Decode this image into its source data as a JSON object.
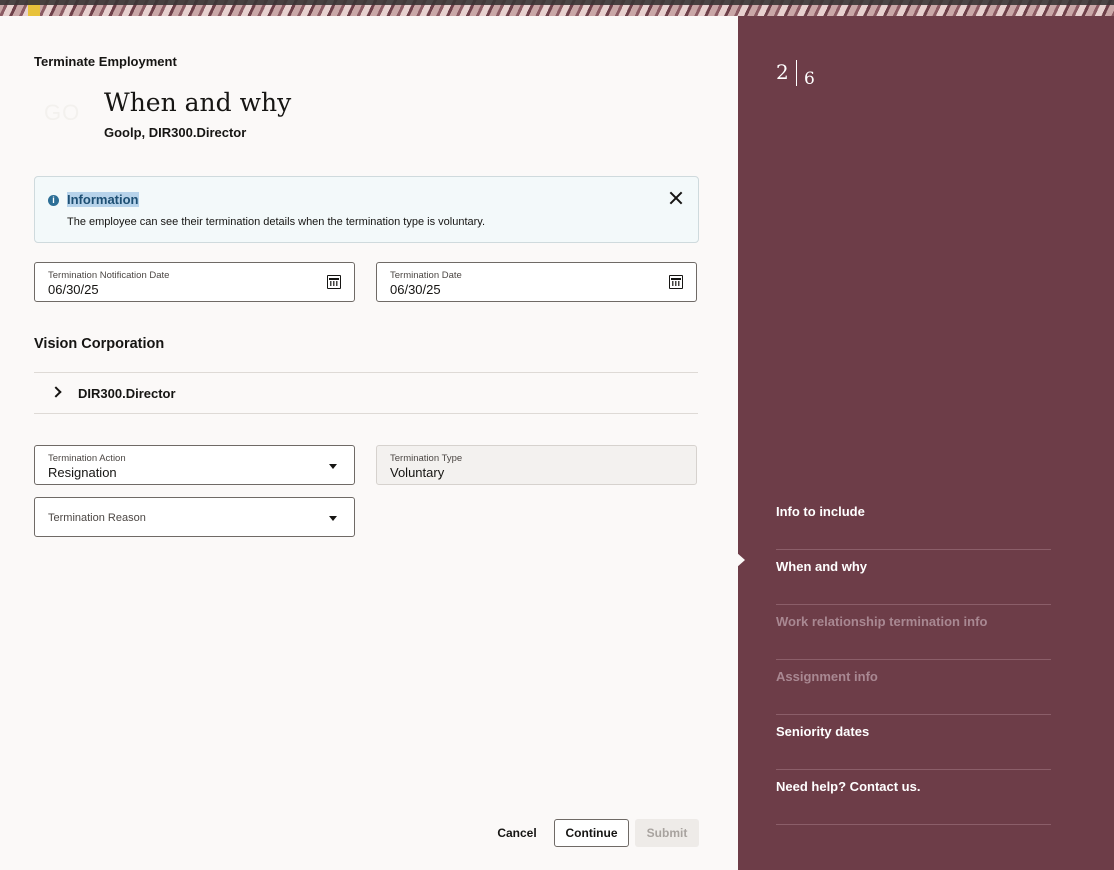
{
  "page": {
    "eyebrow": "Terminate Employment",
    "avatar_initials": "GO",
    "title": "When and why",
    "subtitle": "Goolp, DIR300.Director"
  },
  "info": {
    "title": "Information",
    "message": "The employee can see their termination details when the termination type is voluntary.",
    "icon": "info-icon"
  },
  "dates": {
    "notification_label": "Termination Notification Date",
    "notification_value": "06/30/25",
    "termination_label": "Termination Date",
    "termination_value": "06/30/25"
  },
  "section": {
    "title": "Vision Corporation",
    "row_label": "DIR300.Director"
  },
  "termination": {
    "action_label": "Termination Action",
    "action_value": "Resignation",
    "type_label": "Termination Type",
    "type_value": "Voluntary",
    "reason_label": "Termination Reason"
  },
  "footer": {
    "cancel": "Cancel",
    "continue": "Continue",
    "submit": "Submit"
  },
  "side": {
    "step_current": "2",
    "step_total": "6",
    "items": [
      {
        "label": "Info to include",
        "state": "done"
      },
      {
        "label": "When and why",
        "state": "current"
      },
      {
        "label": "Work relationship termination info",
        "state": "disabled"
      },
      {
        "label": "Assignment info",
        "state": "disabled"
      },
      {
        "label": "Seniority dates",
        "state": "enabled"
      },
      {
        "label": "Need help? Contact us.",
        "state": "enabled"
      }
    ]
  },
  "colors": {
    "side_panel": "#6d3d48",
    "page_bg": "#fbf9f8",
    "info_bg": "#f3f9fa"
  }
}
